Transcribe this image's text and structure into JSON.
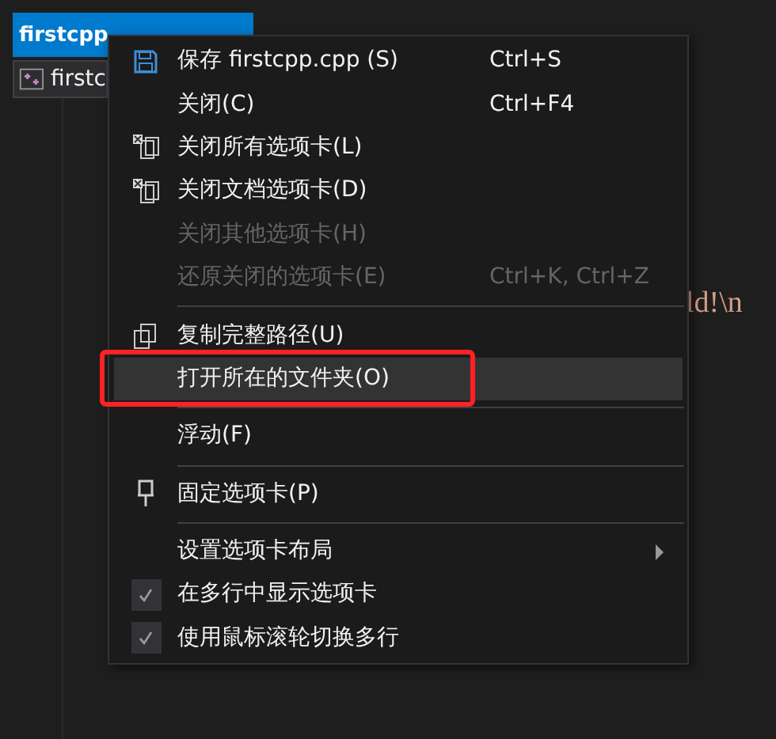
{
  "editor_tab": {
    "title": "firstcpp",
    "selected": true
  },
  "navigation": {
    "file": "firstc"
  },
  "code_fragment": "ld!\\n",
  "menu": {
    "items": [
      {
        "kind": "save",
        "label": "保存 firstcpp.cpp (S)",
        "shortcut": "Ctrl+S",
        "disabled": false
      },
      {
        "kind": "plain",
        "label": "关闭(C)",
        "shortcut": "Ctrl+F4",
        "disabled": false
      },
      {
        "kind": "close-tabs",
        "label": "关闭所有选项卡(L)",
        "disabled": false
      },
      {
        "kind": "close-tabs",
        "label": "关闭文档选项卡(D)",
        "disabled": false
      },
      {
        "kind": "plain",
        "label": "关闭其他选项卡(H)",
        "disabled": true
      },
      {
        "kind": "plain",
        "label": "还原关闭的选项卡(E)",
        "shortcut": "Ctrl+K, Ctrl+Z",
        "disabled": true
      },
      {
        "kind": "separator"
      },
      {
        "kind": "copy",
        "label": "复制完整路径(U)",
        "disabled": false
      },
      {
        "kind": "plain",
        "label": "打开所在的文件夹(O)",
        "disabled": false,
        "selected": true,
        "annotated": true
      },
      {
        "kind": "separator"
      },
      {
        "kind": "plain",
        "label": "浮动(F)",
        "disabled": false
      },
      {
        "kind": "separator"
      },
      {
        "kind": "pin",
        "label": "固定选项卡(P)",
        "disabled": false
      },
      {
        "kind": "separator"
      },
      {
        "kind": "plain",
        "label": "设置选项卡布局",
        "disabled": false,
        "submenu": true
      },
      {
        "kind": "plain",
        "label": "在多行中显示选项卡",
        "disabled": false,
        "checked": true
      },
      {
        "kind": "plain",
        "label": "使用鼠标滚轮切换多行",
        "disabled": false,
        "checked": true
      }
    ]
  }
}
